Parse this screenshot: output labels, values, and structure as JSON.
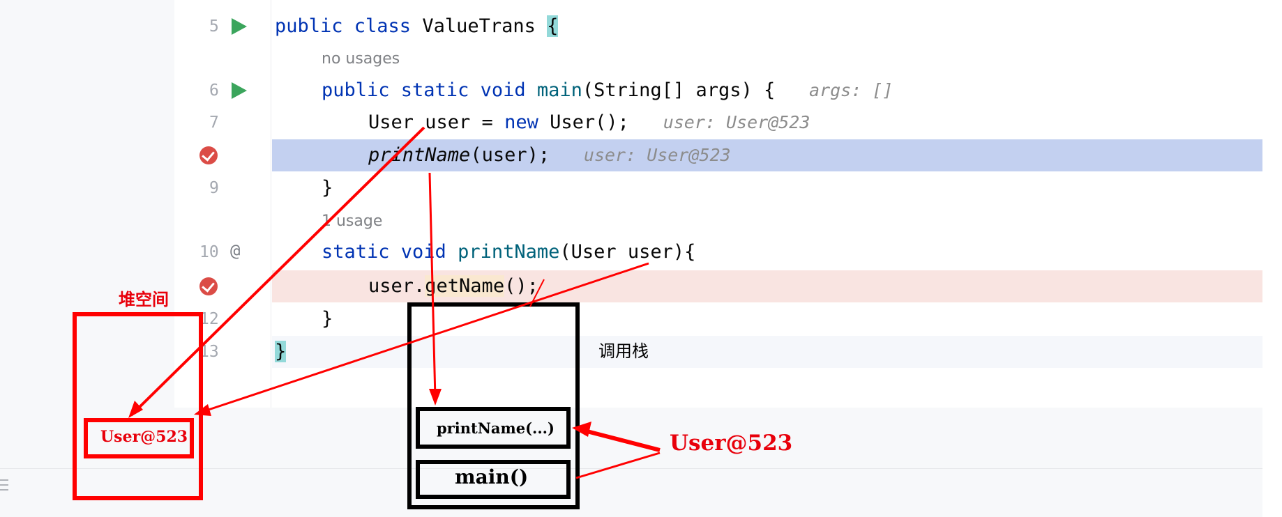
{
  "editor": {
    "lines": [
      {
        "number": "5",
        "marker": "run-icon"
      },
      {
        "number": "6",
        "marker": "run-icon"
      },
      {
        "number": "7",
        "marker": ""
      },
      {
        "number": "",
        "marker": "breakpoint-icon"
      },
      {
        "number": "9",
        "marker": ""
      },
      {
        "number": "10",
        "marker": "implementation-icon"
      },
      {
        "number": "",
        "marker": "breakpoint-icon"
      },
      {
        "number": "12",
        "marker": ""
      },
      {
        "number": "13",
        "marker": ""
      }
    ],
    "implementation_marker": "@",
    "code": {
      "l5_kw": "public class",
      "l5_name": " ValueTrans ",
      "l5_brace": "{",
      "lens1": "no usages",
      "l6_kw": "public static void",
      "l6_fn": " main",
      "l6_rest": "(String[] args) {",
      "l6_hint": "args: []",
      "l7_a": "User user = ",
      "l7_kw": "new",
      "l7_b": " User();",
      "l7_hint": "user: User@523",
      "l8_fn": "printName",
      "l8_rest": "(user);",
      "l8_hint": "user: User@523",
      "l9": "}",
      "lens2": "1 usage",
      "l10_kw": "static void",
      "l10_fn": " printName",
      "l10_rest": "(User user){",
      "l11_a": "user.",
      "l11_fn": "getName",
      "l11_b": "();",
      "l12": "}",
      "l13": "}"
    }
  },
  "annotations": {
    "heap_label": "堆空间",
    "heap_object": "User@523",
    "stack_label": "调用栈",
    "frame_print": "printName(...)",
    "frame_main": "main()",
    "reference_label": "User@523"
  },
  "colors": {
    "annotation_red": "#ff0000",
    "annotation_black": "#000000",
    "current_line": "#c3d0f0",
    "breakpoint_line": "#f9e4e1",
    "keyword": "#0033b3",
    "run_icon": "#3ba55c",
    "breakpoint": "#db4c46"
  }
}
